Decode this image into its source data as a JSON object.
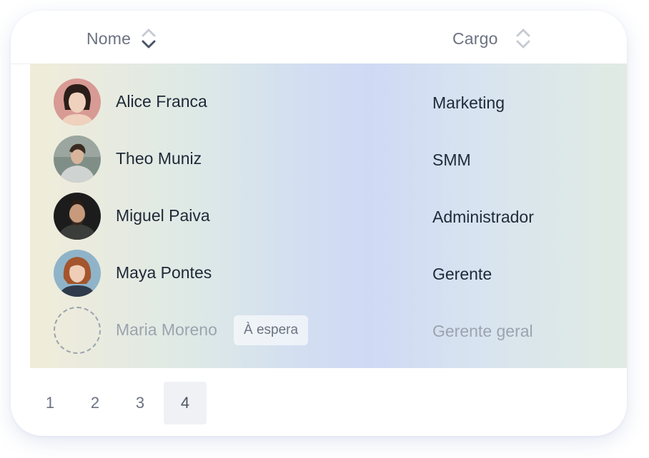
{
  "table": {
    "columns": [
      {
        "label": "Nome",
        "icon": "sort-icon"
      },
      {
        "label": "Cargo",
        "icon": "sort-icon"
      }
    ],
    "rows": [
      {
        "name": "Alice Franca",
        "role": "Marketing",
        "avatar": "avatar-photo"
      },
      {
        "name": "Theo Muniz",
        "role": "SMM",
        "avatar": "avatar-photo"
      },
      {
        "name": "Miguel Paiva",
        "role": "Administrador",
        "avatar": "avatar-photo"
      },
      {
        "name": "Maya Pontes",
        "role": "Gerente",
        "avatar": "avatar-photo"
      },
      {
        "name": "Maria Moreno",
        "role": "Gerente geral",
        "avatar": "avatar-placeholder",
        "badge": "À espera"
      }
    ]
  },
  "pagination": {
    "pages": [
      "1",
      "2",
      "3",
      "4"
    ],
    "active_page": "4"
  },
  "colors": {
    "text_primary": "#1f2937",
    "text_muted": "#9ca3af",
    "header_text": "#6b7280"
  }
}
